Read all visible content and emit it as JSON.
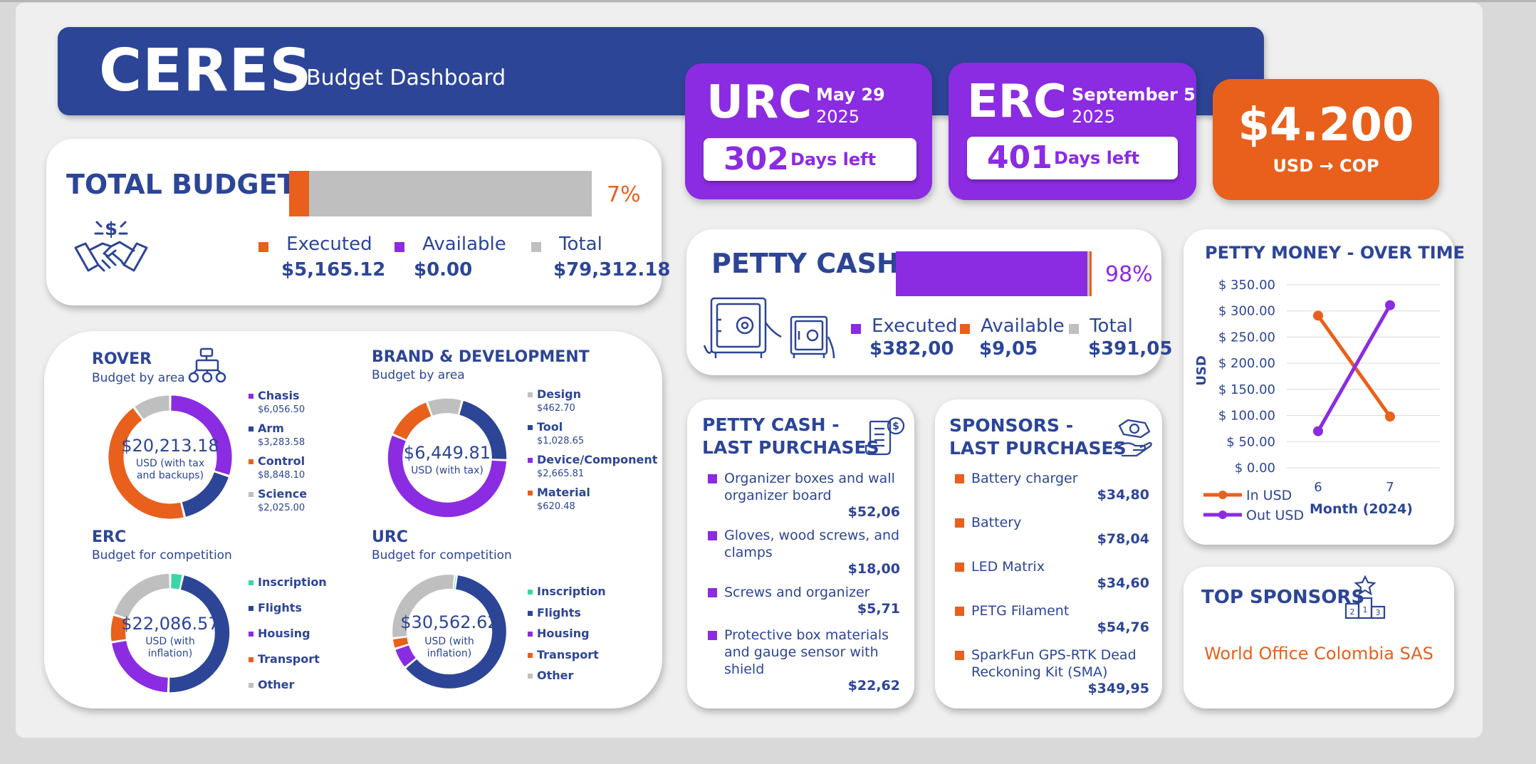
{
  "header": {
    "title": "CERES",
    "subtitle": "Budget Dashboard"
  },
  "deadlines": [
    {
      "code": "URC",
      "date": "May 29",
      "year": "2025",
      "days": "302",
      "days_label": "Days left"
    },
    {
      "code": "ERC",
      "date": "September 5",
      "year": "2025",
      "days": "401",
      "days_label": "Days left"
    }
  ],
  "exchange": {
    "value": "$4.200",
    "label": "USD → COP"
  },
  "total_budget": {
    "title": "TOTAL BUDGET",
    "percent_label": "7%",
    "executed_fraction": 0.065,
    "legend": [
      {
        "label": "Executed",
        "value": "$5,165.12",
        "color": "#e8601c"
      },
      {
        "label": "Available",
        "value": "$0.00",
        "color": "#8b2be2"
      },
      {
        "label": "Total",
        "value": "$79,312.18",
        "color": "#bfbfbf"
      }
    ]
  },
  "rover": {
    "title": "ROVER",
    "subtitle": "Budget by area",
    "center": "$20,213.18",
    "center_note": "USD (with tax and backups)",
    "segments": [
      {
        "label": "Chasis",
        "value": "$6,056.50",
        "amount": 6056.5,
        "color": "#8b2be2"
      },
      {
        "label": "Arm",
        "value": "$3,283.58",
        "amount": 3283.58,
        "color": "#2c4597"
      },
      {
        "label": "Control",
        "value": "$8,848.10",
        "amount": 8848.1,
        "color": "#e8601c"
      },
      {
        "label": "Science",
        "value": "$2,025.00",
        "amount": 2025.0,
        "color": "#bfbfbf"
      }
    ]
  },
  "brand": {
    "title": "BRAND & DEVELOPMENT",
    "subtitle": "Budget by area",
    "center": "$6,449.81",
    "center_note": "USD (with tax)",
    "segments": [
      {
        "label": "Design",
        "value": "$462.70",
        "amount": 462.7,
        "color": "#bfbfbf"
      },
      {
        "label": "Tool",
        "value": "$1,028.65",
        "amount": 1028.65,
        "color": "#2c4597"
      },
      {
        "label": "Device/Component",
        "value": "$2,665.81",
        "amount": 2665.81,
        "color": "#8b2be2"
      },
      {
        "label": "Material",
        "value": "$620.48",
        "amount": 620.48,
        "color": "#e8601c"
      }
    ]
  },
  "erc_budget": {
    "title": "ERC",
    "subtitle": "Budget for competition",
    "center": "$22,086.57",
    "center_note": "USD (with inflation)",
    "segments": [
      {
        "label": "Inscription",
        "amount": 0.035,
        "color": "#3ad6a8"
      },
      {
        "label": "Flights",
        "amount": 0.47,
        "color": "#2c4597"
      },
      {
        "label": "Housing",
        "amount": 0.22,
        "color": "#8b2be2"
      },
      {
        "label": "Transport",
        "amount": 0.075,
        "color": "#e8601c"
      },
      {
        "label": "Other",
        "amount": 0.2,
        "color": "#bfbfbf"
      }
    ]
  },
  "urc_budget": {
    "title": "URC",
    "subtitle": "Budget for competition",
    "center": "$30,562.62",
    "center_note": "USD (with inflation)",
    "segments": [
      {
        "label": "Inscription",
        "amount": 0.005,
        "color": "#3ad6a8"
      },
      {
        "label": "Flights",
        "amount": 0.62,
        "color": "#2c4597"
      },
      {
        "label": "Housing",
        "amount": 0.06,
        "color": "#8b2be2"
      },
      {
        "label": "Transport",
        "amount": 0.03,
        "color": "#e8601c"
      },
      {
        "label": "Other",
        "amount": 0.285,
        "color": "#bfbfbf"
      }
    ]
  },
  "petty_cash": {
    "title": "PETTY CASH",
    "percent_label": "98%",
    "executed_fraction": 0.977,
    "legend": [
      {
        "label": "Executed",
        "value": "$382,00",
        "color": "#8b2be2"
      },
      {
        "label": "Available",
        "value": "$9,05",
        "color": "#e8601c"
      },
      {
        "label": "Total",
        "value": "$391,05",
        "color": "#bfbfbf"
      }
    ]
  },
  "petty_purchases": {
    "title_line1": "PETTY CASH -",
    "title_line2": "LAST PURCHASES",
    "items": [
      {
        "name": "Organizer boxes and wall organizer board",
        "price": "$52,06"
      },
      {
        "name": "Gloves, wood screws, and clamps",
        "price": "$18,00"
      },
      {
        "name": "Screws and organizer",
        "price": "$5,71"
      },
      {
        "name": "Protective box materials and gauge sensor with shield",
        "price": "$22,62"
      }
    ]
  },
  "sponsor_purchases": {
    "title_line1": "SPONSORS -",
    "title_line2": "LAST PURCHASES",
    "items": [
      {
        "name": "Battery charger",
        "price": "$34,80"
      },
      {
        "name": "Battery",
        "price": "$78,04"
      },
      {
        "name": "LED Matrix",
        "price": "$34,60"
      },
      {
        "name": "PETG Filament",
        "price": "$54,76"
      },
      {
        "name": "SparkFun GPS-RTK Dead Reckoning Kit (SMA)",
        "price": "$349,95"
      }
    ]
  },
  "petty_chart": {
    "title": "PETTY MONEY - OVER TIME",
    "chart_data": {
      "type": "line",
      "x": [
        6,
        7
      ],
      "xlabel": "Month (2024)",
      "ylabel": "USD",
      "ylim": [
        0,
        350
      ],
      "yticks": [
        "$ 0.00",
        "$ 50.00",
        "$ 100.00",
        "$ 150.00",
        "$ 200.00",
        "$ 250.00",
        "$ 300.00",
        "$ 350.00"
      ],
      "series": [
        {
          "name": "In USD",
          "values": [
            291,
            98
          ],
          "color": "#e8601c"
        },
        {
          "name": "Out USD",
          "values": [
            70,
            311
          ],
          "color": "#8b2be2"
        }
      ]
    }
  },
  "top_sponsors": {
    "title": "TOP SPONSORS",
    "name": "World Office Colombia SAS"
  }
}
